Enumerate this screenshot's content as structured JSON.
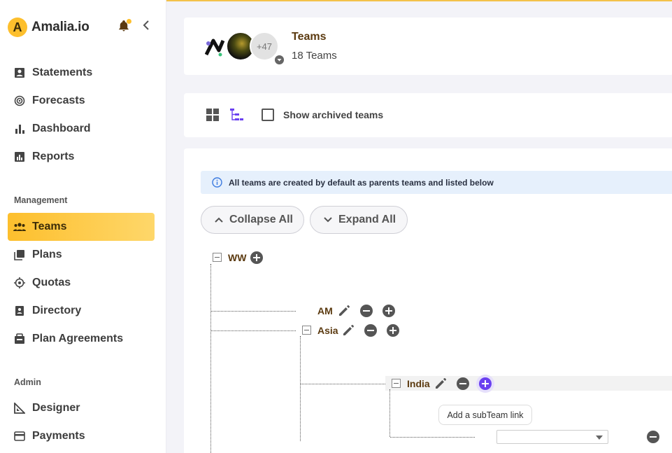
{
  "brand": {
    "name": "Amalia.io",
    "logo_letter": "A",
    "accent": "#fdbf2d"
  },
  "sidebar": {
    "items": [
      {
        "label": "Statements",
        "icon": "statement-icon"
      },
      {
        "label": "Forecasts",
        "icon": "forecast-icon"
      },
      {
        "label": "Dashboard",
        "icon": "bar-chart-icon"
      },
      {
        "label": "Reports",
        "icon": "report-icon"
      }
    ],
    "management_label": "Management",
    "management_items": [
      {
        "label": "Teams",
        "icon": "teams-icon",
        "active": true
      },
      {
        "label": "Plans",
        "icon": "plans-icon"
      },
      {
        "label": "Quotas",
        "icon": "quotas-icon"
      },
      {
        "label": "Directory",
        "icon": "directory-icon"
      },
      {
        "label": "Plan Agreements",
        "icon": "agreement-icon"
      }
    ],
    "admin_label": "Admin",
    "admin_items": [
      {
        "label": "Designer",
        "icon": "designer-icon"
      },
      {
        "label": "Payments",
        "icon": "payments-icon"
      }
    ]
  },
  "header": {
    "title": "Teams",
    "subtitle": "18 Teams",
    "avatar_more": "+47"
  },
  "toolbar": {
    "show_archived_label": "Show archived teams",
    "show_archived_checked": false
  },
  "tree": {
    "info_text": "All teams are created by default as parents teams and listed below",
    "collapse_all": "Collapse All",
    "expand_all": "Expand All",
    "nodes": {
      "ww": "WW",
      "am": "AM",
      "asia": "Asia",
      "india": "India"
    },
    "tooltip": "Add a subTeam link",
    "subteam_select_value": ""
  }
}
